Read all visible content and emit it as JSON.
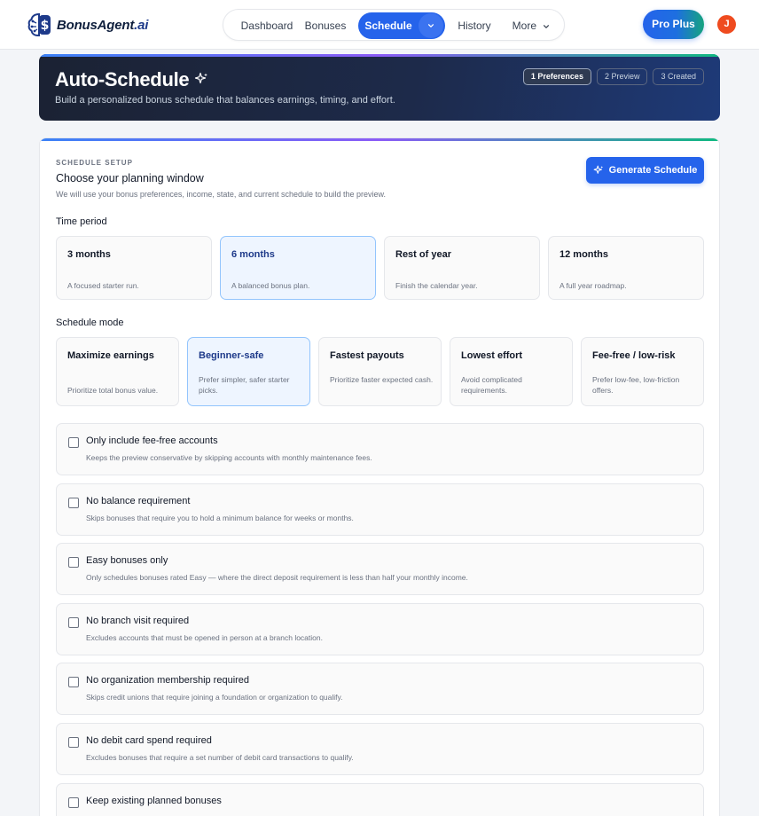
{
  "brand": {
    "name": "BonusAgent",
    "tld": ".ai"
  },
  "nav": {
    "items": [
      "Dashboard",
      "Bonuses",
      "Schedule",
      "History",
      "More"
    ],
    "active": "Schedule"
  },
  "header": {
    "plan_label": "Pro Plus",
    "avatar_initial": "J"
  },
  "hero": {
    "title": "Auto-Schedule",
    "subtitle": "Build a personalized bonus schedule that balances earnings, timing, and effort.",
    "steps": [
      {
        "label": "1 Preferences",
        "active": true
      },
      {
        "label": "2 Preview",
        "active": false
      },
      {
        "label": "3 Created",
        "active": false
      }
    ]
  },
  "setup": {
    "eyebrow": "SCHEDULE SETUP",
    "title": "Choose your planning window",
    "subtitle": "We will use your bonus preferences, income, state, and current schedule to build the preview.",
    "generate_label": "Generate Schedule",
    "time_period_label": "Time period",
    "periods": [
      {
        "title": "3 months",
        "desc": "A focused starter run.",
        "selected": false
      },
      {
        "title": "6 months",
        "desc": "A balanced bonus plan.",
        "selected": true
      },
      {
        "title": "Rest of year",
        "desc": "Finish the calendar year.",
        "selected": false
      },
      {
        "title": "12 months",
        "desc": "A full year roadmap.",
        "selected": false
      }
    ],
    "mode_label": "Schedule mode",
    "modes": [
      {
        "title": "Maximize earnings",
        "desc": "Prioritize total bonus value.",
        "selected": false
      },
      {
        "title": "Beginner-safe",
        "desc": "Prefer simpler, safer starter picks.",
        "selected": true
      },
      {
        "title": "Fastest payouts",
        "desc": "Prioritize faster expected cash.",
        "selected": false
      },
      {
        "title": "Lowest effort",
        "desc": "Avoid complicated requirements.",
        "selected": false
      },
      {
        "title": "Fee-free / low-risk",
        "desc": "Prefer low-fee, low-friction offers.",
        "selected": false
      }
    ],
    "filters": [
      {
        "title": "Only include fee-free accounts",
        "desc": "Keeps the preview conservative by skipping accounts with monthly maintenance fees.",
        "checked": false
      },
      {
        "title": "No balance requirement",
        "desc": "Skips bonuses that require you to hold a minimum balance for weeks or months.",
        "checked": false
      },
      {
        "title": "Easy bonuses only",
        "desc": "Only schedules bonuses rated Easy — where the direct deposit requirement is less than half your monthly income.",
        "checked": false
      },
      {
        "title": "No branch visit required",
        "desc": "Excludes accounts that must be opened in person at a branch location.",
        "checked": false
      },
      {
        "title": "No organization membership required",
        "desc": "Skips credit unions that require joining a foundation or organization to qualify.",
        "checked": false
      },
      {
        "title": "No debit card spend required",
        "desc": "Excludes bonuses that require a set number of debit card transactions to qualify.",
        "checked": false
      },
      {
        "title": "Keep existing planned bonuses",
        "desc": "",
        "checked": false
      }
    ]
  }
}
